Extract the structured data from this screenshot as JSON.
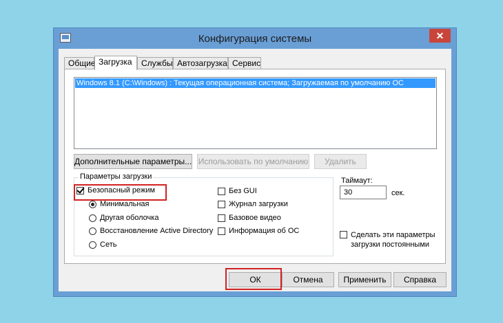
{
  "window": {
    "title": "Конфигурация системы",
    "close_glyph": "✕"
  },
  "tabs": [
    {
      "label": "Общие",
      "active": false
    },
    {
      "label": "Загрузка",
      "active": true
    },
    {
      "label": "Службы",
      "active": false
    },
    {
      "label": "Автозагрузка",
      "active": false
    },
    {
      "label": "Сервис",
      "active": false
    }
  ],
  "os_list": {
    "items": [
      {
        "label": "Windows 8.1 (C:\\Windows) : Текущая операционная система; Загружаемая по умолчанию ОС",
        "selected": true
      }
    ]
  },
  "actions": {
    "advanced": "Дополнительные параметры...",
    "set_default": "Использовать по умолчанию",
    "delete": "Удалить"
  },
  "boot_options": {
    "group_label": "Параметры загрузки",
    "safe_mode": {
      "label": "Безопасный режим",
      "checked": true
    },
    "safe_mode_options": [
      {
        "label": "Минимальная",
        "checked": true
      },
      {
        "label": "Другая оболочка",
        "checked": false
      },
      {
        "label": "Восстановление Active Directory",
        "checked": false
      },
      {
        "label": "Сеть",
        "checked": false
      }
    ],
    "no_gui": {
      "label": "Без GUI",
      "checked": false
    },
    "boot_log": {
      "label": "Журнал загрузки",
      "checked": false
    },
    "base_video": {
      "label": "Базовое видео",
      "checked": false
    },
    "os_info": {
      "label": "Информация  об ОС",
      "checked": false
    }
  },
  "timeout": {
    "label": "Таймаут:",
    "value": "30",
    "unit": "сек."
  },
  "persistent": {
    "label_line1": "Сделать эти параметры",
    "label_line2": "загрузки постоянными",
    "checked": false
  },
  "footer": {
    "ok": "ОК",
    "cancel": "Отмена",
    "apply": "Применить",
    "help": "Справка"
  },
  "colors": {
    "background": "#8fd3e8",
    "window_frame": "#6a9fd6",
    "close_button": "#c9453a",
    "selection": "#3399ff",
    "highlight": "#d22020"
  },
  "icons": [
    "app-icon",
    "close-icon"
  ]
}
